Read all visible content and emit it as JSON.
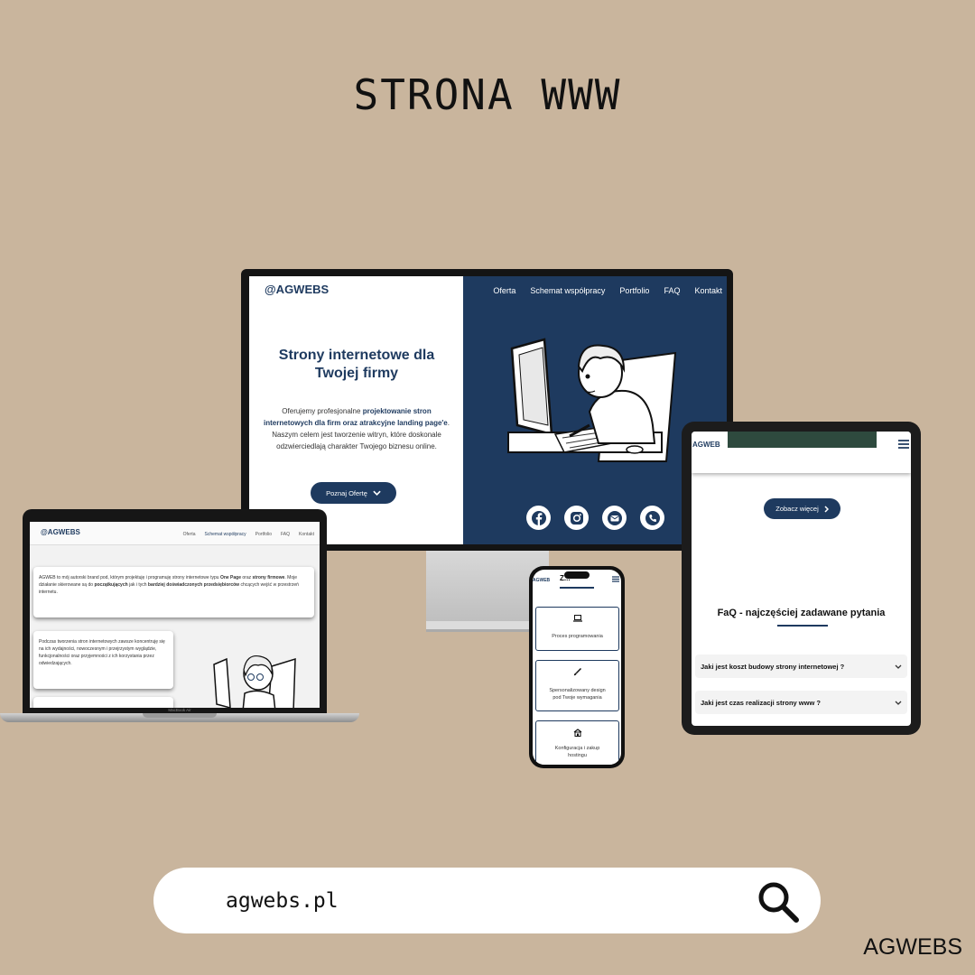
{
  "header": {
    "title": "STRONA WWW"
  },
  "monitor": {
    "logo": "@AGWEBS",
    "nav": [
      "Oferta",
      "Schemat współpracy",
      "Portfolio",
      "FAQ",
      "Kontakt"
    ],
    "hero_heading": "Strony internetowe dla Twojej firmy",
    "hero_text": {
      "t1": "Oferujemy profesjonalne ",
      "b1": "projektowanie stron internetowych dla firm oraz atrakcyjne landing page'e",
      "t2": ". Naszym celem jest tworzenie witryn, które doskonale odzwierciedlają charakter Twojego biznesu online."
    },
    "cta": "Poznaj Ofertę",
    "social_icons": [
      "facebook-icon",
      "instagram-icon",
      "mail-icon",
      "phone-icon"
    ]
  },
  "laptop": {
    "logo": "@AGWEBS",
    "nav": [
      "Oferta",
      "Schemat współpracy",
      "Portfolio",
      "FAQ",
      "Kontakt"
    ],
    "card1": {
      "t1": "AGWEB to mój autorski brand pod, którym projektuję i programuję strony internetowe typu ",
      "b1": "One Page",
      "t2": " oraz ",
      "b2": "strony firmowe",
      "t3": ". Moje działanie skierowane są do ",
      "b3": "początkujących",
      "t4": " jak i tych ",
      "b4": "bardziej doświadczonych przedsiębiorców",
      "t5": " chcących wejść w przestrzeń internetu."
    },
    "card2": "Podczas tworzenia stron internetowych zawsze koncentruję się na ich wydajności, nowoczesnym i przejrzystym wyglądzie, funkcjonalności oraz przyjemności z ich korzystania przez odwiedzających.",
    "model": "MacBook Air"
  },
  "tablet": {
    "logo": "AGWEB",
    "cta": "Zobacz więcej",
    "faq_heading": "FaQ - najczęściej zadawane pytania",
    "faq": [
      {
        "q": "Jaki jest koszt budowy strony internetowej ?"
      },
      {
        "q": "Jaki jest czas realizacji strony www ?"
      }
    ]
  },
  "phone": {
    "logo": "AGWEB",
    "heading": "Z...",
    "cards": [
      {
        "icon": "laptop-icon",
        "label": "Proces programowania"
      },
      {
        "icon": "brush-icon",
        "label": "Spersonalizowany design pod Twoje wymagania"
      },
      {
        "icon": "server-icon",
        "label": "Konfiguracja i zakup hostingu"
      }
    ]
  },
  "search": {
    "text": "agwebs.pl",
    "icon": "search-icon"
  },
  "brand": "AGWEBS",
  "colors": {
    "background": "#c9b59d",
    "navy": "#1e3a5f",
    "white": "#ffffff"
  }
}
